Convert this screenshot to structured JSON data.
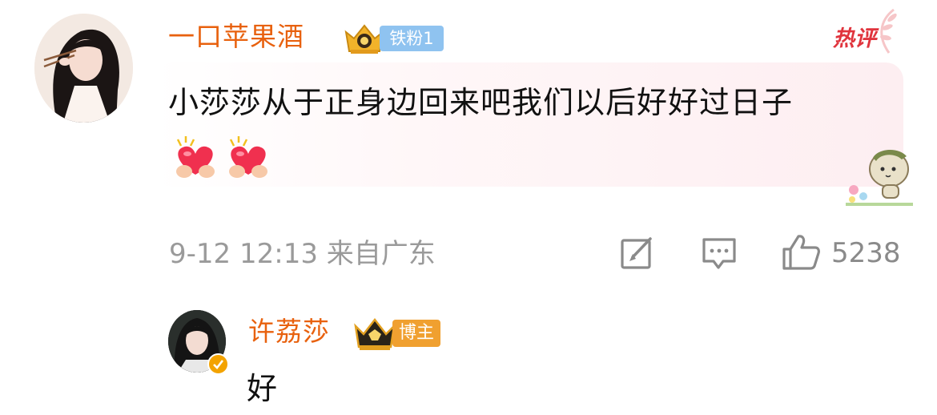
{
  "comment": {
    "username": "一口苹果酒",
    "fan_badge": "铁粉1",
    "hot_tag": "热评",
    "text": "小莎莎从于正身边回来吧我们以后好好过日子",
    "emojis": [
      "heart-hands-emoji",
      "heart-hands-emoji"
    ],
    "time_location": "9-12 12:13 来自广东",
    "actions": {
      "share_icon": "share-edit-icon",
      "reply_icon": "comment-icon",
      "like_icon": "thumbs-up-icon",
      "like_count": "5238"
    }
  },
  "reply": {
    "username": "许荔莎",
    "badge": "博主",
    "text": "好"
  },
  "colors": {
    "username": "#e8610e",
    "fan_badge": "#8fc3f0",
    "host_badge": "#f0a030",
    "hot_tag": "#e0343d",
    "meta": "#9a9a9a"
  }
}
